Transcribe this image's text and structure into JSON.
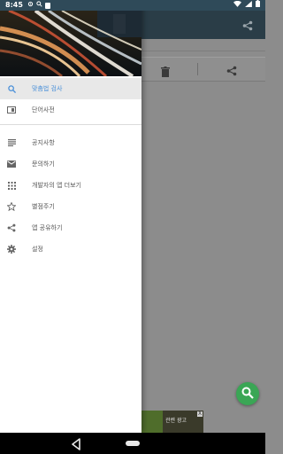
{
  "status_bar": {
    "time": "8:45"
  },
  "drawer": {
    "header_image": "city-night-highway-light-trails",
    "primary_items": [
      {
        "label": "맞춤법 검사",
        "icon": "search-icon",
        "active": true
      },
      {
        "label": "단어사전",
        "icon": "dictionary-icon",
        "active": false
      }
    ],
    "secondary_items": [
      {
        "label": "공지사항",
        "icon": "notes-icon"
      },
      {
        "label": "문의하기",
        "icon": "mail-icon"
      },
      {
        "label": "개발자의 앱 더보기",
        "icon": "apps-grid-icon"
      },
      {
        "label": "별점주기",
        "icon": "star-icon"
      },
      {
        "label": "앱 공유하기",
        "icon": "share-icon"
      },
      {
        "label": "설정",
        "icon": "gear-icon"
      }
    ]
  },
  "ad": {
    "text": "관련 광고",
    "close": "X"
  },
  "colors": {
    "status_bar": "#2f4a59",
    "active_item_text": "#4a90d9",
    "fab": "#3aa655"
  }
}
